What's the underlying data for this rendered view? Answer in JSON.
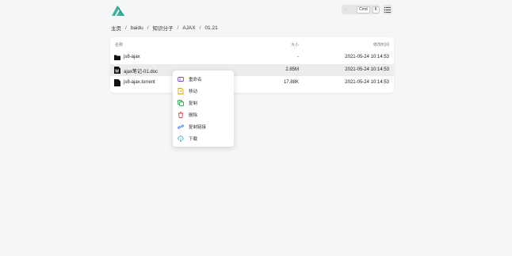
{
  "header": {
    "search_keys": [
      "Cmd",
      "K"
    ]
  },
  "breadcrumb": [
    "主页",
    "baidu",
    "知识分子",
    "AJAX",
    "01.21"
  ],
  "table": {
    "columns": [
      "名称",
      "大小",
      "修改时间"
    ],
    "rows": [
      {
        "name": "js8-ajax",
        "size": "-",
        "modified": "2021-05-24 10:14:53",
        "icon": "folder-icon"
      },
      {
        "name": "ajax笔记-01.doc",
        "size": "2.85M",
        "modified": "2021-05-24 10:14:53",
        "icon": "word-file-icon"
      },
      {
        "name": "js8-ajax.torrent",
        "size": "17.88K",
        "modified": "2021-05-24 10:14:53",
        "icon": "file-icon"
      }
    ]
  },
  "context_menu": [
    {
      "label": "重命名",
      "icon": "rename-icon",
      "color": "#7a4fd1"
    },
    {
      "label": "移动",
      "icon": "move-icon",
      "color": "#e0a100"
    },
    {
      "label": "复制",
      "icon": "copy-icon",
      "color": "#2fa84f"
    },
    {
      "label": "删除",
      "icon": "delete-icon",
      "color": "#e24b4b"
    },
    {
      "label": "复制链接",
      "icon": "link-icon",
      "color": "#2e7de0"
    },
    {
      "label": "下载",
      "icon": "download-icon",
      "color": "#2aa6c9"
    }
  ],
  "colors": {
    "logo": "#3bb3a2",
    "row_highlight": "#ececec"
  }
}
